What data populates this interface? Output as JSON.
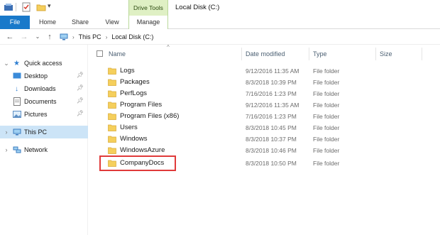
{
  "window": {
    "title": "Local Disk (C:)"
  },
  "contextual_tab": {
    "label": "Drive Tools"
  },
  "ribbon": {
    "tabs": [
      {
        "label": "File"
      },
      {
        "label": "Home"
      },
      {
        "label": "Share"
      },
      {
        "label": "View"
      },
      {
        "label": "Manage"
      }
    ]
  },
  "address": {
    "crumbs": [
      "This PC",
      "Local Disk (C:)"
    ]
  },
  "nav": {
    "quick_access": "Quick access",
    "items": [
      {
        "label": "Desktop",
        "icon": "desktop-icon"
      },
      {
        "label": "Downloads",
        "icon": "download-arrow-icon"
      },
      {
        "label": "Documents",
        "icon": "documents-icon"
      },
      {
        "label": "Pictures",
        "icon": "pictures-icon"
      }
    ],
    "this_pc": "This PC",
    "network": "Network"
  },
  "columns": {
    "name": "Name",
    "date": "Date modified",
    "type": "Type",
    "size": "Size"
  },
  "files": [
    {
      "name": "Logs",
      "date": "9/12/2016 11:35 AM",
      "type": "File folder"
    },
    {
      "name": "Packages",
      "date": "8/3/2018 10:39 PM",
      "type": "File folder"
    },
    {
      "name": "PerfLogs",
      "date": "7/16/2016 1:23 PM",
      "type": "File folder"
    },
    {
      "name": "Program Files",
      "date": "9/12/2016 11:35 AM",
      "type": "File folder"
    },
    {
      "name": "Program Files (x86)",
      "date": "7/16/2016 1:23 PM",
      "type": "File folder"
    },
    {
      "name": "Users",
      "date": "8/3/2018 10:45 PM",
      "type": "File folder"
    },
    {
      "name": "Windows",
      "date": "8/3/2018 10:37 PM",
      "type": "File folder"
    },
    {
      "name": "WindowsAzure",
      "date": "8/3/2018 10:46 PM",
      "type": "File folder"
    },
    {
      "name": "CompanyDocs",
      "date": "8/3/2018 10:50 PM",
      "type": "File folder"
    }
  ],
  "colors": {
    "file_tab": "#1979ca",
    "drive_tools": "#dff0c4",
    "selection": "#cce4f7",
    "folder": "#f5cf5c",
    "highlight": "#e03a3a"
  }
}
